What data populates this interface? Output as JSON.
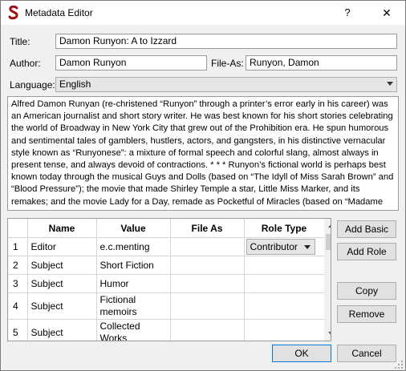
{
  "window": {
    "title": "Metadata Editor",
    "help": "?",
    "close": "✕"
  },
  "colors": {
    "accent": "#0078d7",
    "app_icon": "#a01010"
  },
  "icons": {
    "app": "app-logo-icon",
    "help": "question-mark-icon",
    "close": "close-icon"
  },
  "form": {
    "title_label": "Title:",
    "title_value": "Damon Runyon: A to Izzard",
    "author_label": "Author:",
    "author_value": "Damon Runyon",
    "file_as_label": "File-As:",
    "file_as_value": "Runyon, Damon",
    "language_label": "Language:",
    "language_value": "English"
  },
  "description": "Alfred Damon Runyan (re-christened “Runyon” through a printer’s error early in his career) was an American journalist and short story writer. He was best known for his short stories celebrating the world of Broadway in New York City that grew out of the Prohibition era. He spun humorous and sentimental tales of gamblers, hustlers, actors, and gangsters, in his distinctive vernacular style known as “Runyonese”: a mixture of formal speech and colorful slang, almost always in present tense, and always devoid of contractions. * * * Runyon’s fictional world is perhaps best known today through the musical Guys and Dolls (based on “The Idyll of Miss Sarah Brown” and “Blood Pressure”); the movie that made Shirley Temple a star, Little Miss Marker, and its remakes; and the movie Lady for a Day, remade as Pocketful of Miracles (based on “Madame La Gimp”). * * * (—Extracted and adapted from Wikipedia)",
  "table": {
    "headers": {
      "num": "",
      "name": "Name",
      "value": "Value",
      "file_as": "File As",
      "role_type": "Role Type"
    },
    "rows": [
      {
        "num": "1",
        "name": "Editor",
        "value": "e.c.menting",
        "file_as": "",
        "role": "Contributor"
      },
      {
        "num": "2",
        "name": "Subject",
        "value": "Short Fiction",
        "file_as": "",
        "role": ""
      },
      {
        "num": "3",
        "name": "Subject",
        "value": "Humor",
        "file_as": "",
        "role": ""
      },
      {
        "num": "4",
        "name": "Subject",
        "value": "Fictional memoirs",
        "file_as": "",
        "role": ""
      },
      {
        "num": "5",
        "name": "Subject",
        "value": "Collected Works",
        "file_as": "",
        "role": ""
      }
    ]
  },
  "buttons": {
    "add_basic": "Add Basic",
    "add_role": "Add Role",
    "copy": "Copy",
    "remove": "Remove",
    "ok": "OK",
    "cancel": "Cancel"
  }
}
